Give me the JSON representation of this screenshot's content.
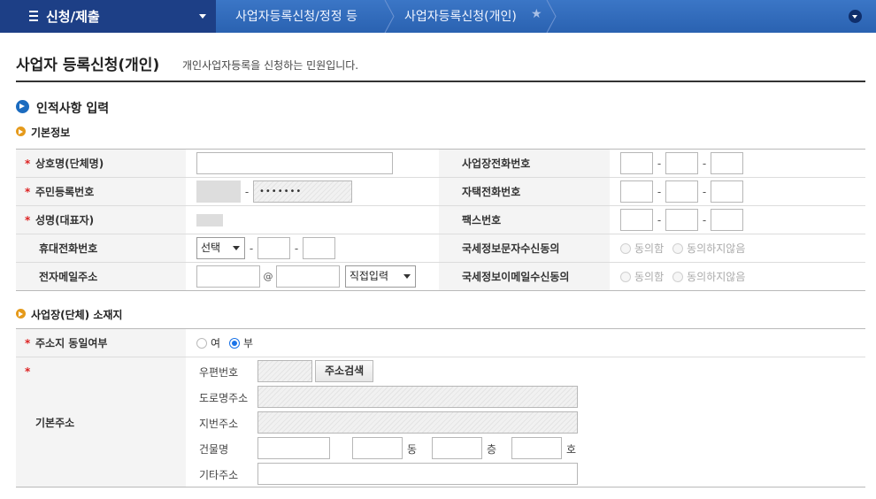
{
  "topbar": {
    "menu_title": "신청/제출",
    "breadcrumb_1": "사업자등록신청/정정 등",
    "breadcrumb_2": "사업자등록신청(개인)"
  },
  "page": {
    "title": "사업자 등록신청(개인)",
    "description": "개인사업자등록을 신청하는 민원입니다."
  },
  "section_personal": {
    "title": "인적사항 입력",
    "subsection": "기본정보",
    "labels": {
      "trade_name": "상호명(단체명)",
      "resident_no": "주민등록번호",
      "name": "성명(대표자)",
      "mobile": "휴대전화번호",
      "email": "전자메일주소",
      "biz_phone": "사업장전화번호",
      "home_phone": "자택전화번호",
      "fax": "팩스번호",
      "sms_consent": "국세정보문자수신동의",
      "email_consent": "국세정보이메일수신동의"
    },
    "resident_back_masked": "•••••••",
    "mobile_select": "선택",
    "email_at": "@",
    "email_domain_select": "직접입력",
    "consent_agree": "동의함",
    "consent_disagree": "동의하지않음",
    "dash": "-"
  },
  "section_location": {
    "subsection": "사업장(단체) 소재지",
    "same_address_label": "주소지 동일여부",
    "yes_label": "여",
    "no_label": "부",
    "basic_address_label": "기본주소",
    "zip_label": "우편번호",
    "search_button": "주소검색",
    "road_label": "도로명주소",
    "lot_label": "지번주소",
    "building_label": "건물명",
    "dong": "동",
    "floor": "층",
    "ho": "호",
    "etc_label": "기타주소"
  }
}
